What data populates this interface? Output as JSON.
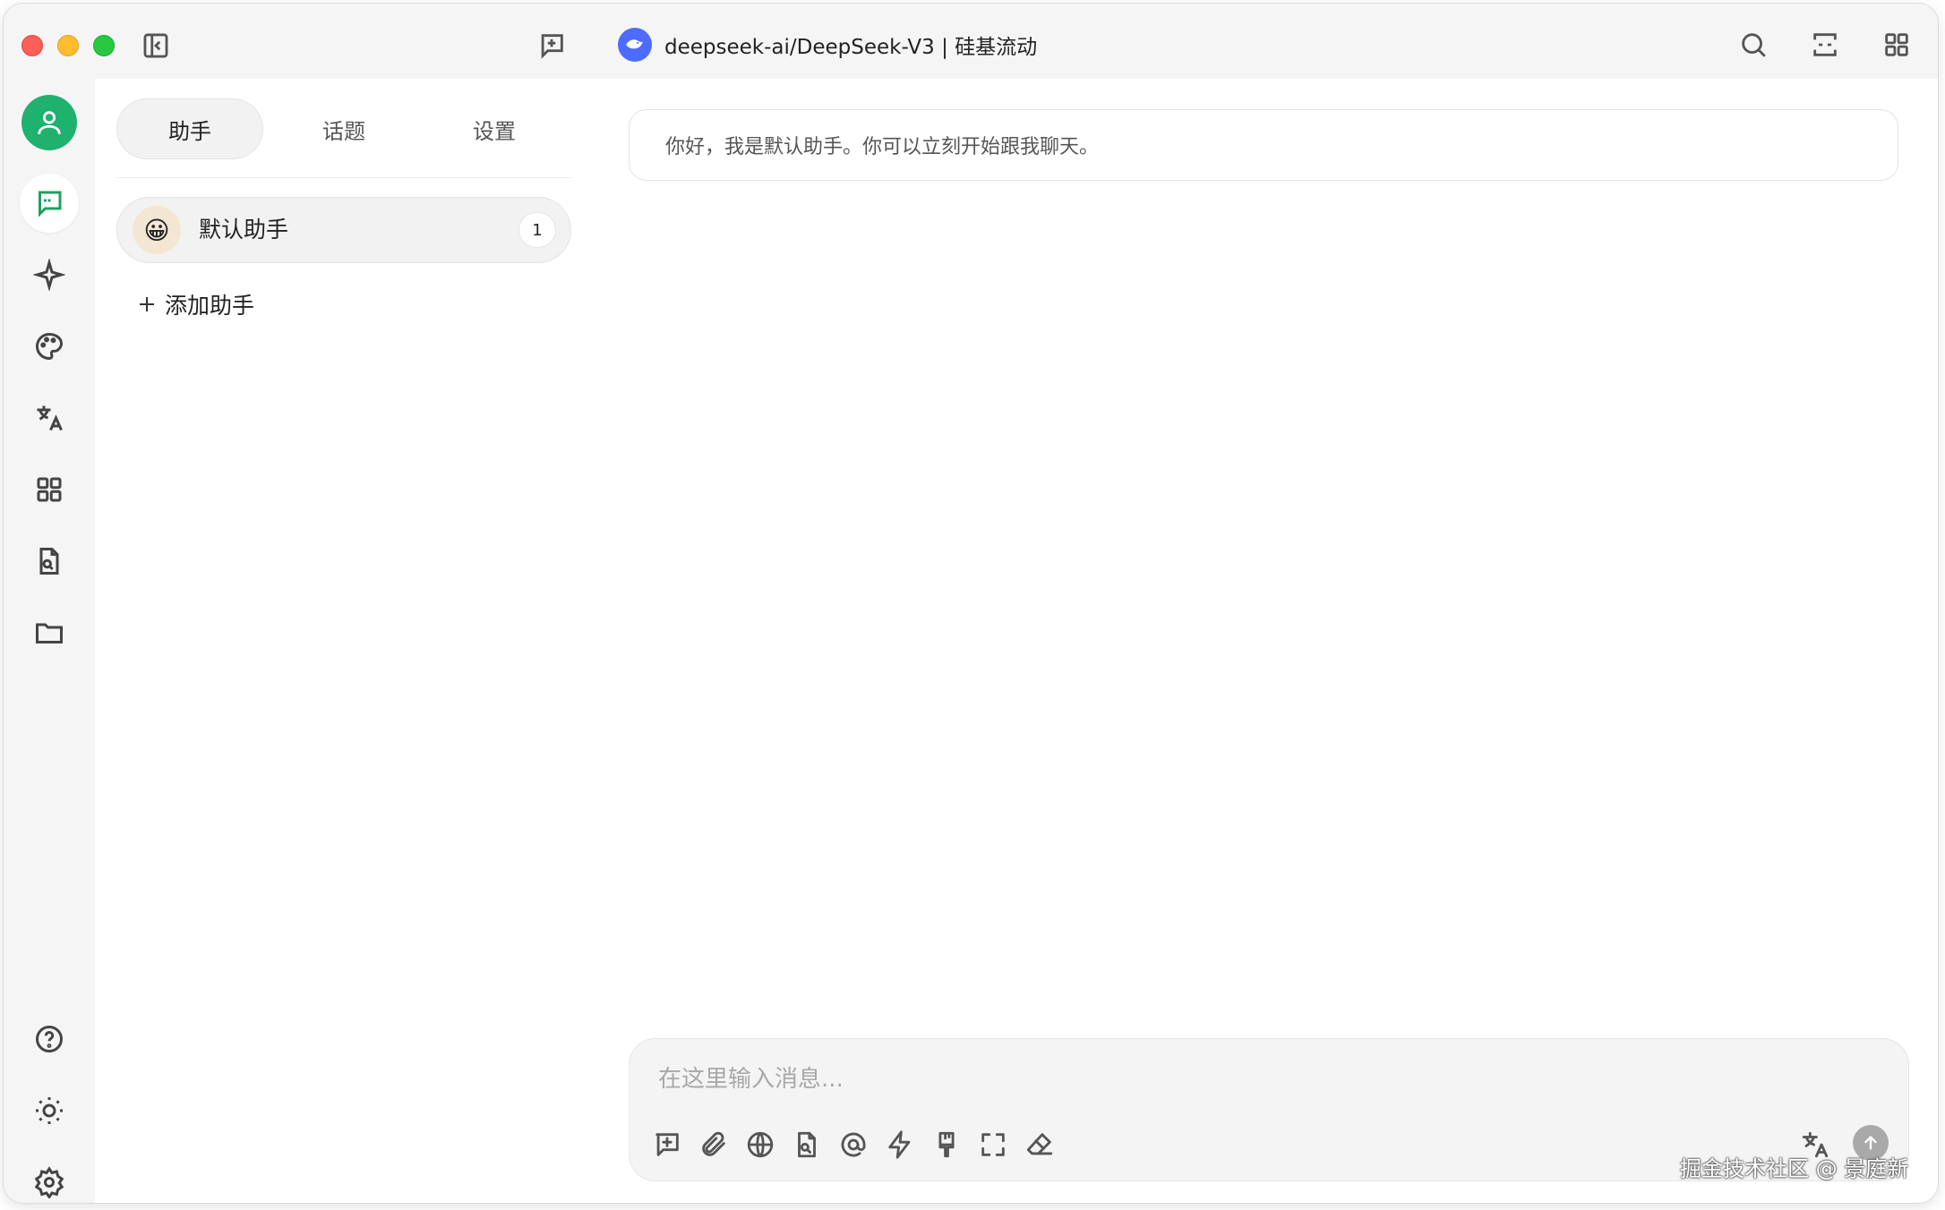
{
  "window": {
    "title": "deepseek-ai/DeepSeek-V3 | 硅基流动",
    "model_logo_icon": "deepseek-whale-icon",
    "accent_color": "#1fb16e",
    "model_logo_color": "#4d6bfe"
  },
  "titlebar": {
    "icons": [
      "sidebar-toggle-icon",
      "new-topic-icon",
      "search-icon",
      "expand-icon",
      "apps-grid-icon"
    ]
  },
  "rail": {
    "top_items": [
      "user-avatar-icon",
      "chat-icon",
      "sparkle-icon",
      "palette-icon",
      "translate-icon",
      "apps-icon",
      "file-search-icon",
      "folder-icon"
    ],
    "bottom_items": [
      "help-icon",
      "theme-sun-icon",
      "settings-gear-icon"
    ]
  },
  "sidebar": {
    "tabs": [
      {
        "label": "助手",
        "active": true
      },
      {
        "label": "话题",
        "active": false
      },
      {
        "label": "设置",
        "active": false
      }
    ],
    "assistants": [
      {
        "emoji": "😀",
        "name": "默认助手",
        "count": "1"
      }
    ],
    "add_assistant_label": "添加助手"
  },
  "chat": {
    "greeting": "你好，我是默认助手。你可以立刻开始跟我聊天。",
    "input_placeholder": "在这里输入消息...",
    "toolbar_icons": [
      "new-topic-icon",
      "attachment-icon",
      "web-search-icon",
      "knowledge-file-icon",
      "mention-icon",
      "quick-phrase-icon",
      "clear-brush-icon",
      "fullscreen-icon",
      "eraser-icon",
      "translate-icon",
      "send-icon"
    ]
  },
  "watermark": "掘金技术社区 @ 景庭新"
}
